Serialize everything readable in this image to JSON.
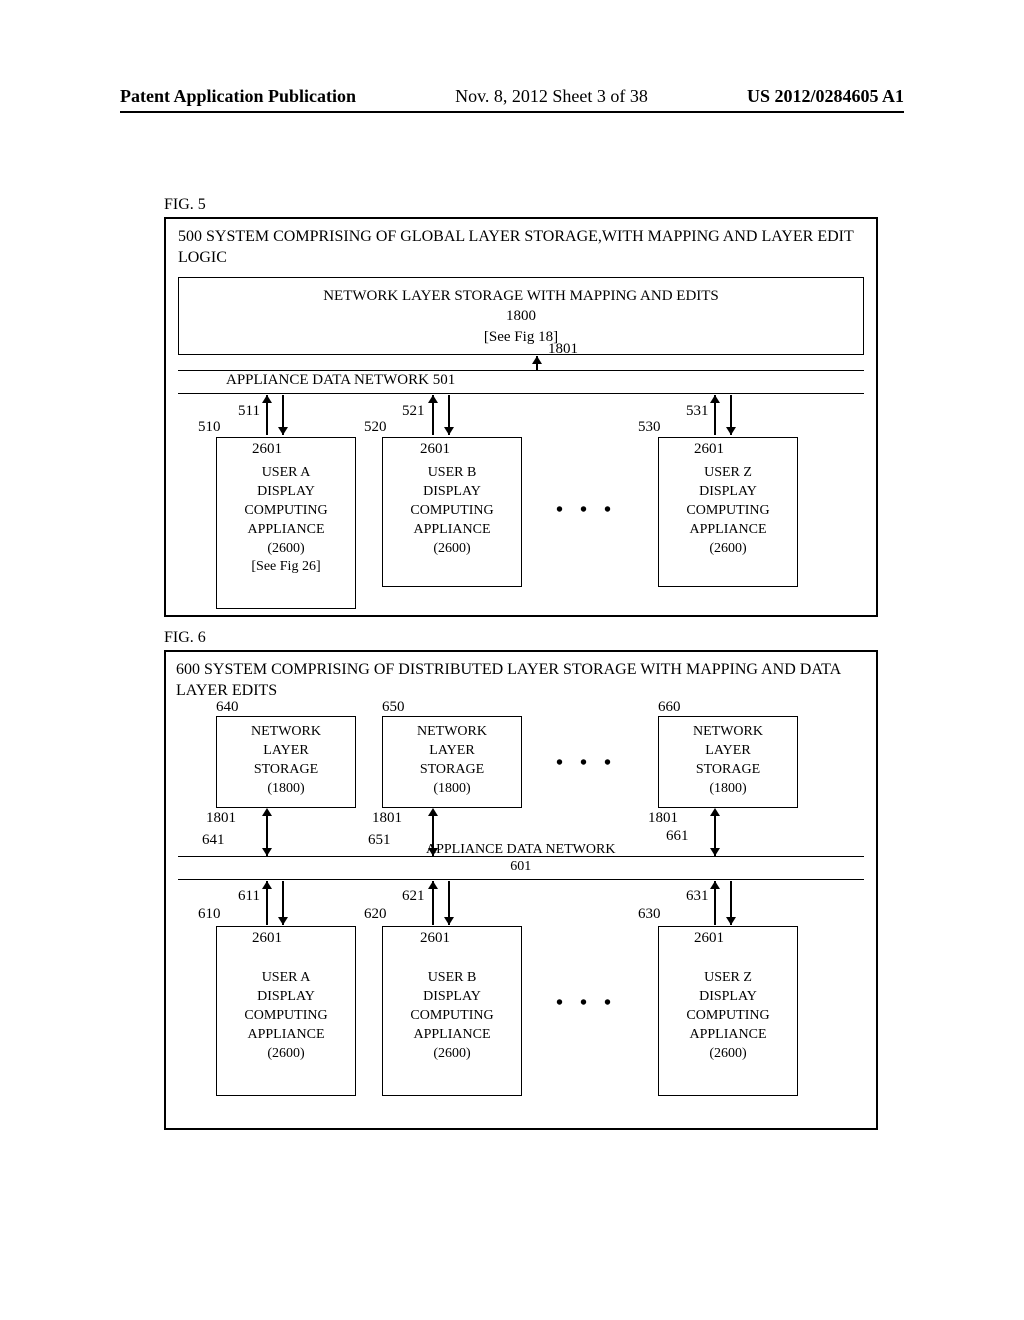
{
  "header": {
    "left": "Patent Application Publication",
    "center": "Nov. 8, 2012   Sheet 3 of 38",
    "right": "US 2012/0284605 A1"
  },
  "fig5": {
    "label": "FIG. 5",
    "title_prefix": "500  ",
    "title": "SYSTEM COMPRISING OF GLOBAL LAYER STORAGE,WITH MAPPING AND LAYER EDIT LOGIC",
    "network_box_line1": "NETWORK LAYER STORAGE WITH MAPPING AND EDITS",
    "network_box_line2": "1800",
    "network_box_line3": "[See Fig 18]",
    "ref_1801": "1801",
    "appliance_network": "APPLIANCE DATA NETWORK 501",
    "l_511": "511",
    "l_510": "510",
    "l_521": "521",
    "l_520": "520",
    "l_531": "531",
    "l_530": "530",
    "box_2601": "2601",
    "userA": {
      "l1": "USER A",
      "l2": "DISPLAY",
      "l3": "COMPUTING",
      "l4": "APPLIANCE",
      "l5": "(2600)",
      "l6": "[See Fig 26]"
    },
    "userB": {
      "l1": "USER B",
      "l2": "DISPLAY",
      "l3": "COMPUTING",
      "l4": "APPLIANCE",
      "l5": "(2600)"
    },
    "userZ": {
      "l1": "USER Z",
      "l2": "DISPLAY",
      "l3": "COMPUTING",
      "l4": "APPLIANCE",
      "l5": "(2600)"
    },
    "dots": "•  •  •"
  },
  "fig6": {
    "label": "FIG. 6",
    "title_prefix": "600 ",
    "title": "SYSTEM COMPRISING OF DISTRIBUTED LAYER STORAGE WITH MAPPING AND DATA LAYER EDITS",
    "l_640": "640",
    "l_650": "650",
    "l_660": "660",
    "storage": {
      "l1": "NETWORK",
      "l2": "LAYER",
      "l3": "STORAGE",
      "l4": "(1800)"
    },
    "l_1801": "1801",
    "l_641": "641",
    "l_651": "651",
    "l_661": "661",
    "network": "APPLIANCE DATA NETWORK",
    "network_ref": "601",
    "l_611": "611",
    "l_621": "621",
    "l_631": "631",
    "l_610": "610",
    "l_620": "620",
    "l_630": "630",
    "box_2601": "2601",
    "userA": {
      "l1": "USER A",
      "l2": "DISPLAY",
      "l3": "COMPUTING",
      "l4": "APPLIANCE",
      "l5": "(2600)"
    },
    "userB": {
      "l1": "USER B",
      "l2": "DISPLAY",
      "l3": "COMPUTING",
      "l4": "APPLIANCE",
      "l5": "(2600)"
    },
    "userZ": {
      "l1": "USER Z",
      "l2": "DISPLAY",
      "l3": "COMPUTING",
      "l4": "APPLIANCE",
      "l5": "(2600)"
    },
    "dots": "•  •  •"
  }
}
